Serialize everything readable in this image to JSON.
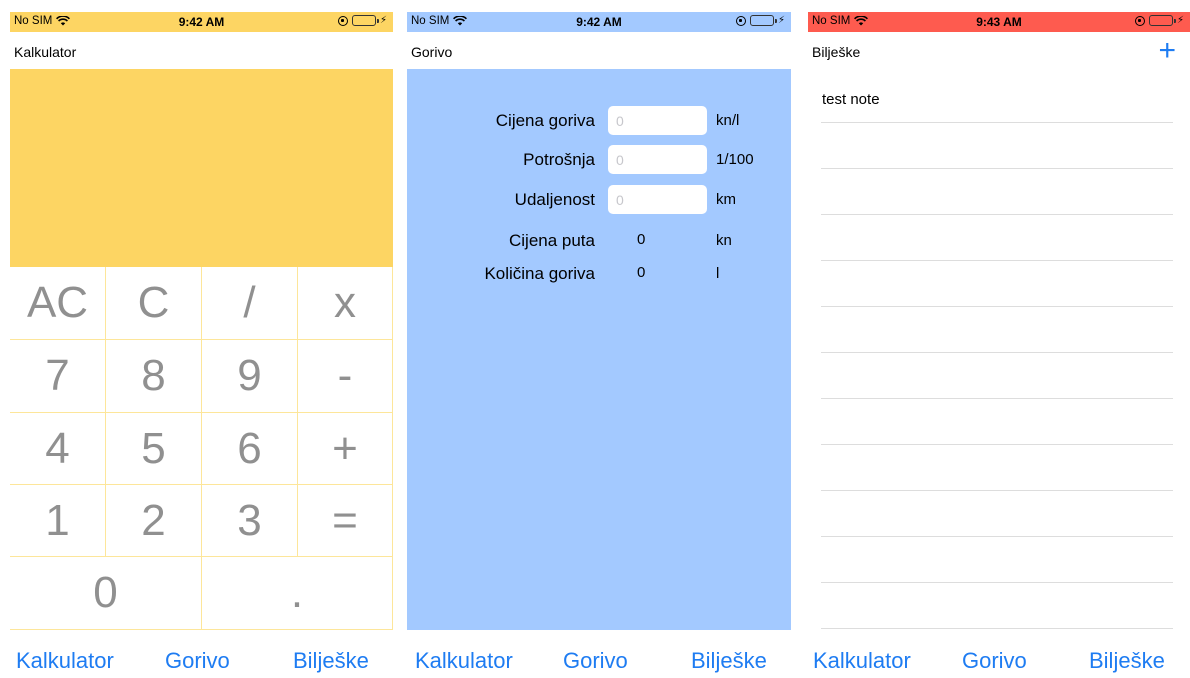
{
  "colors": {
    "calc_status_bg": "#fdd563",
    "calc_display_bg": "#fdd563",
    "gorivo_status_bg": "#a3c9ff",
    "gorivo_body_bg": "#a3c9ff",
    "notes_status_bg": "#fe5b4f",
    "tab_text": "#1e7cf2",
    "key_text": "#909090",
    "key_border": "#fde69a"
  },
  "tabs": {
    "kalkulator": "Kalkulator",
    "gorivo": "Gorivo",
    "biljeske": "Bilješke"
  },
  "screens": {
    "calculator": {
      "status": {
        "carrier": "No SIM",
        "time": "9:42 AM"
      },
      "title": "Kalkulator",
      "keys": [
        "AC",
        "C",
        "/",
        "x",
        "7",
        "8",
        "9",
        "-",
        "4",
        "5",
        "6",
        "+",
        "1",
        "2",
        "3",
        "=",
        "0",
        "."
      ]
    },
    "gorivo": {
      "status": {
        "carrier": "No SIM",
        "time": "9:42 AM"
      },
      "title": "Gorivo",
      "fields": [
        {
          "label": "Cijena goriva",
          "placeholder": "0",
          "unit": "kn/l"
        },
        {
          "label": "Potrošnja",
          "placeholder": "0",
          "unit": "1/100"
        },
        {
          "label": "Udaljenost",
          "placeholder": "0",
          "unit": "km"
        }
      ],
      "results": [
        {
          "label": "Cijena puta",
          "value": "0",
          "unit": "kn"
        },
        {
          "label": "Količina goriva",
          "value": "0",
          "unit": "l"
        }
      ]
    },
    "notes": {
      "status": {
        "carrier": "No SIM",
        "time": "9:43 AM"
      },
      "title": "Bilješke",
      "add_label": "+",
      "items": [
        "test note"
      ]
    }
  }
}
